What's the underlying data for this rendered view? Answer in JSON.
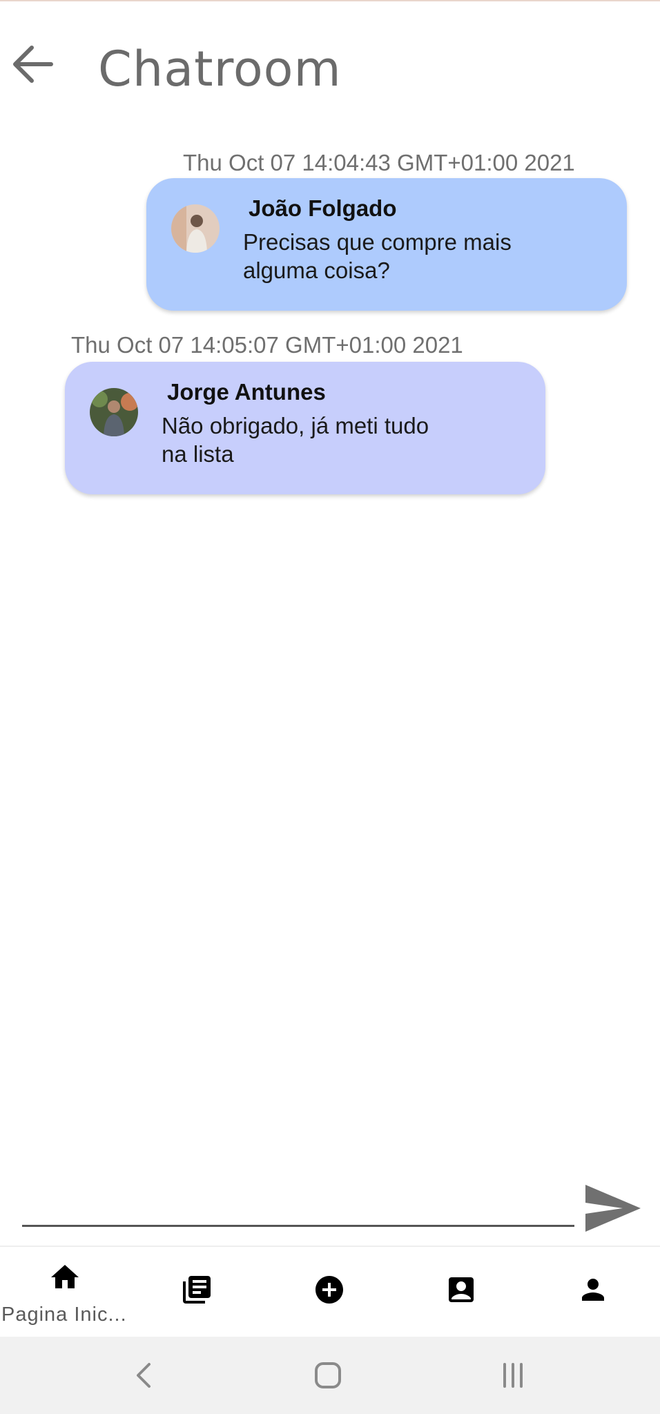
{
  "header": {
    "title": "Chatroom",
    "back_icon": "arrow-left-icon"
  },
  "messages": [
    {
      "timestamp": "Thu Oct 07 14:04:43 GMT+01:00 2021",
      "sender": "João Folgado",
      "text": " Precisas que compre mais\nalguma coisa?",
      "bubble_color": "#aecbfd"
    },
    {
      "timestamp": "Thu Oct 07 14:05:07 GMT+01:00 2021",
      "sender": "Jorge Antunes",
      "text": " Não obrigado, já meti tudo\nna lista",
      "bubble_color": "#c7cefc"
    }
  ],
  "composer": {
    "value": "",
    "placeholder": "",
    "send_icon": "send-icon"
  },
  "bottom_nav": {
    "items": [
      {
        "icon": "home-icon",
        "label": "Pagina Inic..."
      },
      {
        "icon": "list-icon"
      },
      {
        "icon": "add-circle-icon"
      },
      {
        "icon": "contact-card-icon"
      },
      {
        "icon": "person-icon"
      }
    ]
  },
  "system_nav": {
    "back_icon": "system-back-icon",
    "home_icon": "system-home-icon",
    "recents_icon": "system-recents-icon"
  }
}
